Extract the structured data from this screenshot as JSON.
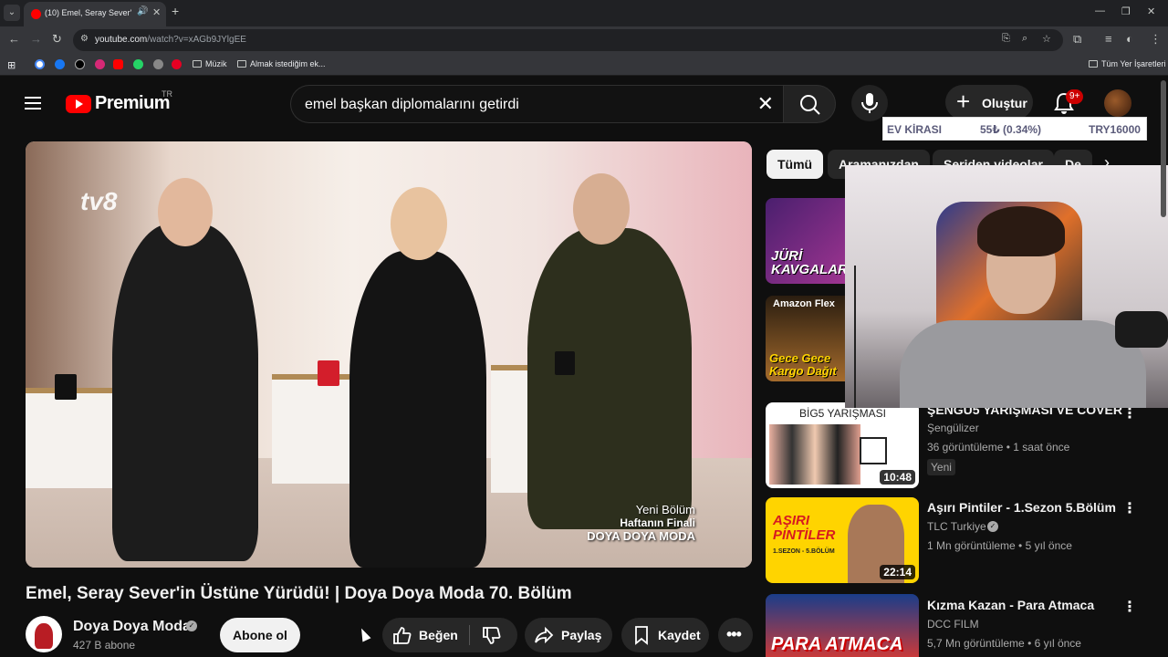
{
  "browser": {
    "tab_title": "(10) Emel, Seray Sever'in Üs...",
    "url_host": "youtube.com",
    "url_path": "/watch?v=xAGb9JYlgEE",
    "bookmarks": [
      {
        "label": "Müzik"
      },
      {
        "label": "Almak istediğim ek..."
      }
    ],
    "all_bookmarks": "Tüm Yer İşaretleri"
  },
  "masthead": {
    "brand": "Premium",
    "region": "TR",
    "search_value": "emel başkan diplomalarını getirdi",
    "create_label": "Oluştur",
    "notif_count": "9+"
  },
  "ticker": {
    "name": "EV KİRASI",
    "change": "55₺ (0.34%)",
    "value": "TRY16000"
  },
  "player": {
    "watermark": "tv8",
    "overlay_line1": "Yeni Bölüm",
    "overlay_line2": "Haftanın Finali",
    "overlay_line3": "DOYA DOYA MODA"
  },
  "video": {
    "title": "Emel, Seray Sever'in Üstüne Yürüdü! | Doya Doya Moda 70. Bölüm",
    "channel": "Doya Doya Moda",
    "subscribers": "427 B abone",
    "subscribe_label": "Abone ol",
    "like_label": "Beğen",
    "share_label": "Paylaş",
    "save_label": "Kaydet"
  },
  "chips": [
    "Tümü",
    "Aramanızdan",
    "Seriden videolar",
    "De"
  ],
  "recommendations": [
    {
      "thumb_text": "JÜRİ KAVGALAR",
      "title": "",
      "channel": "",
      "meta": "",
      "duration": ""
    },
    {
      "thumb_text": "Gece Gece Kargo Dağıt",
      "thumb_brand": "Amazon Flex",
      "title": "",
      "channel": "",
      "meta": "",
      "duration": ""
    },
    {
      "thumb_text": "BİG5 YARIŞMASI",
      "title": "ŞENGÜ5 YARIŞMASI VE COVER",
      "channel": "Şengülizer",
      "meta": "36 görüntüleme • 1 saat önce",
      "duration": "10:48",
      "badge": "Yeni"
    },
    {
      "thumb_text": "AŞIRI PİNTİLER",
      "thumb_sub": "1.SEZON - 5.BÖLÜM",
      "title": "Aşırı Pintiler - 1.Sezon 5.Bölüm",
      "channel": "TLC Turkiye",
      "meta": "1 Mn görüntüleme • 5 yıl önce",
      "duration": "22:14"
    },
    {
      "thumb_text": "PARA ATMACA",
      "title": "Kızma Kazan - Para Atmaca",
      "channel": "DCC FILM",
      "meta": "5,7 Mn görüntüleme • 6 yıl önce",
      "duration": ""
    }
  ],
  "colors": {
    "youtube_red": "#ff0000",
    "background": "#0f0f0f",
    "chip_bg": "#272727"
  }
}
